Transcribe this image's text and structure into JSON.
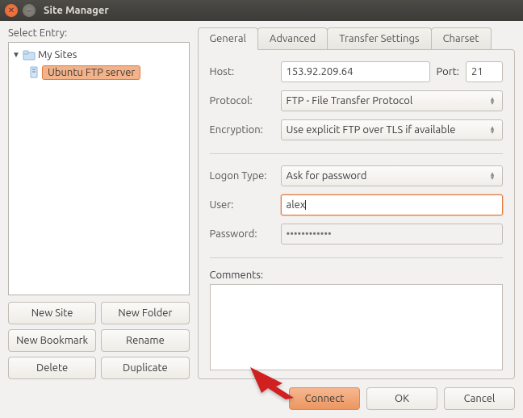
{
  "window": {
    "title": "Site Manager"
  },
  "left": {
    "select_label": "Select Entry:",
    "tree": {
      "root": "My Sites",
      "item": "Ubuntu FTP server"
    },
    "buttons": {
      "new_site": "New Site",
      "new_folder": "New Folder",
      "new_bookmark": "New Bookmark",
      "rename": "Rename",
      "delete": "Delete",
      "duplicate": "Duplicate"
    }
  },
  "tabs": {
    "general": "General",
    "advanced": "Advanced",
    "transfer": "Transfer Settings",
    "charset": "Charset"
  },
  "form": {
    "host_label": "Host:",
    "host_value": "153.92.209.64",
    "port_label": "Port:",
    "port_value": "21",
    "protocol_label": "Protocol:",
    "protocol_value": "FTP - File Transfer Protocol",
    "encryption_label": "Encryption:",
    "encryption_value": "Use explicit FTP over TLS if available",
    "logon_label": "Logon Type:",
    "logon_value": "Ask for password",
    "user_label": "User:",
    "user_value": "alex",
    "password_label": "Password:",
    "password_placeholder": "••••••••••••",
    "comments_label": "Comments:",
    "comments_value": ""
  },
  "footer": {
    "connect": "Connect",
    "ok": "OK",
    "cancel": "Cancel"
  }
}
